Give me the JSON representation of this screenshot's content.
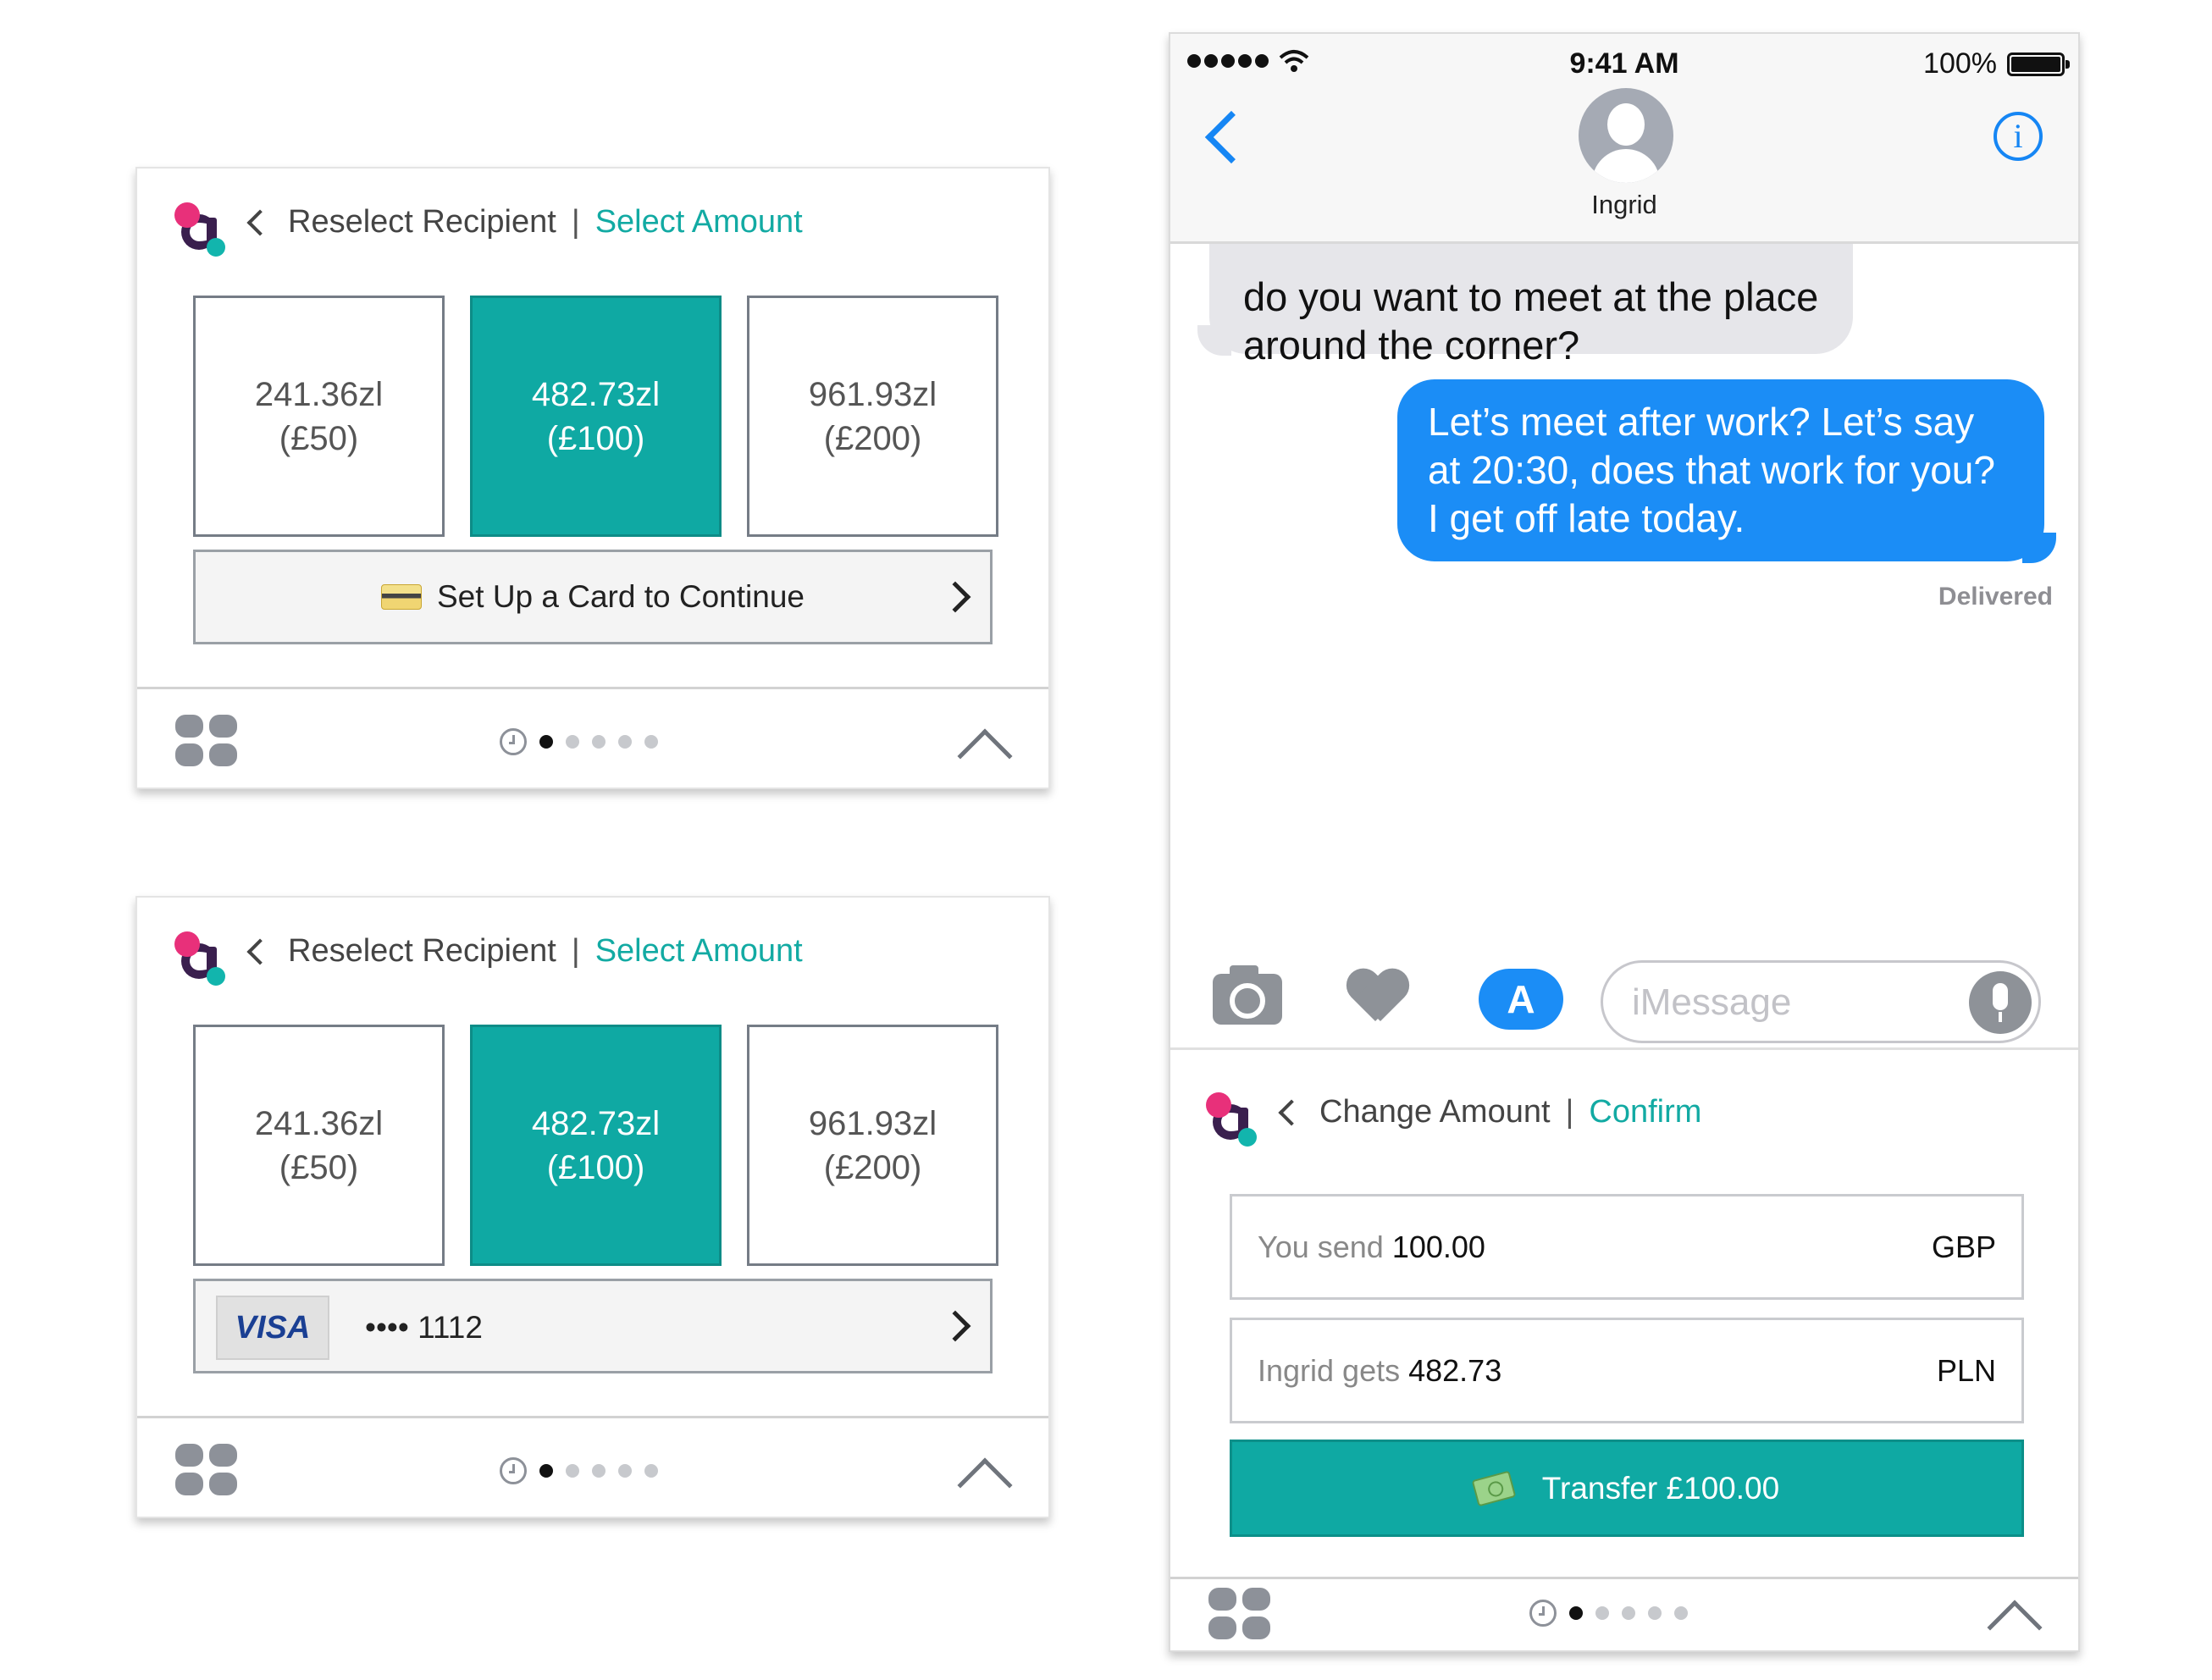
{
  "colors": {
    "teal_accent": "#12aaa3",
    "selected_tile": "#0fa9a3",
    "imessage_blue": "#1b8df6",
    "received_bubble": "#e6e6ea",
    "logo_pink": "#e8307a",
    "logo_purple": "#3a1f4e"
  },
  "widget_1": {
    "back_label": "Reselect Recipient",
    "separator": "|",
    "current_step": "Select Amount",
    "amounts": [
      {
        "pln": "241.36zl",
        "gbp": "(£50)",
        "selected": false
      },
      {
        "pln": "482.73zl",
        "gbp": "(£100)",
        "selected": true
      },
      {
        "pln": "961.93zl",
        "gbp": "(£200)",
        "selected": false
      }
    ],
    "card_button_icon": "credit-card-icon",
    "card_button_label": "Set Up a Card to Continue"
  },
  "widget_2": {
    "back_label": "Reselect Recipient",
    "separator": "|",
    "current_step": "Select Amount",
    "amounts": [
      {
        "pln": "241.36zl",
        "gbp": "(£50)",
        "selected": false
      },
      {
        "pln": "482.73zl",
        "gbp": "(£100)",
        "selected": true
      },
      {
        "pln": "961.93zl",
        "gbp": "(£200)",
        "selected": false
      }
    ],
    "card_brand": "VISA",
    "card_number": "•••• 1112"
  },
  "drawer": {
    "page_count": 6,
    "active_page": 1
  },
  "phone": {
    "status_bar": {
      "time": "9:41 AM",
      "battery": "100%"
    },
    "contact_name": "Ingrid",
    "messages": {
      "incoming": "do you want to meet at the place around the corner?",
      "outgoing": "Let’s meet after work? Let’s say at 20:30, does that work for you? I get off late today.",
      "status": "Delivered"
    },
    "composer": {
      "placeholder": "iMessage",
      "appstore_glyph": "A"
    },
    "extension": {
      "back_label": "Change Amount",
      "separator": "|",
      "current_step": "Confirm",
      "send_label": "You send",
      "send_value": "100.00",
      "send_currency": "GBP",
      "receive_label": "Ingrid gets",
      "receive_value": "482.73",
      "receive_currency": "PLN",
      "transfer_label": "Transfer £100.00"
    },
    "info_glyph": "i"
  }
}
